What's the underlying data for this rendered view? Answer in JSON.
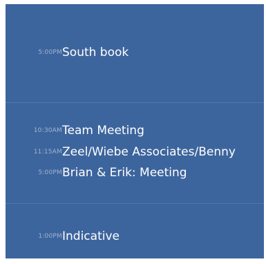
{
  "colors": {
    "panel_background": "#3d659d",
    "divider": "#5278ad",
    "time_text": "#9fb4d3",
    "title_text": "#ffffff"
  },
  "sections": [
    {
      "events": [
        {
          "time": "5:00PM",
          "title": "South book"
        }
      ]
    },
    {
      "events": [
        {
          "time": "10:30AM",
          "title": "Team Meeting"
        },
        {
          "time": "11:15AM",
          "title": "Zeel/Wiebe Associates/Benny"
        },
        {
          "time": "5:00PM",
          "title": "Brian & Erik: Meeting"
        }
      ]
    },
    {
      "events": [
        {
          "time": "1:00PM",
          "title": "Indicative"
        }
      ]
    }
  ]
}
